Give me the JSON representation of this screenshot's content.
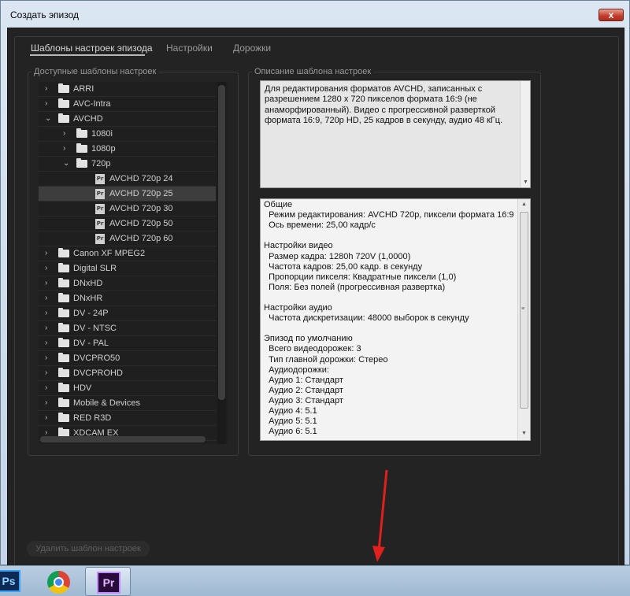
{
  "window": {
    "title": "Создать эпизод",
    "close_label": "x"
  },
  "tabs": [
    {
      "label": "Шаблоны настроек эпизода",
      "active": true
    },
    {
      "label": "Настройки",
      "active": false
    },
    {
      "label": "Дорожки",
      "active": false
    }
  ],
  "presets_panel": {
    "label": "Доступные шаблоны настроек",
    "tree": [
      {
        "label": "ARRI",
        "type": "folder",
        "level": 0,
        "expanded": false
      },
      {
        "label": "AVC-Intra",
        "type": "folder",
        "level": 0,
        "expanded": false
      },
      {
        "label": "AVCHD",
        "type": "folder",
        "level": 0,
        "expanded": true
      },
      {
        "label": "1080i",
        "type": "folder",
        "level": 1,
        "expanded": false
      },
      {
        "label": "1080p",
        "type": "folder",
        "level": 1,
        "expanded": false
      },
      {
        "label": "720p",
        "type": "folder",
        "level": 1,
        "expanded": true
      },
      {
        "label": "AVCHD 720p 24",
        "type": "preset",
        "level": 2
      },
      {
        "label": "AVCHD 720p 25",
        "type": "preset",
        "level": 2,
        "selected": true
      },
      {
        "label": "AVCHD 720p 30",
        "type": "preset",
        "level": 2
      },
      {
        "label": "AVCHD 720p 50",
        "type": "preset",
        "level": 2
      },
      {
        "label": "AVCHD 720p 60",
        "type": "preset",
        "level": 2
      },
      {
        "label": "Canon XF MPEG2",
        "type": "folder",
        "level": 0,
        "expanded": false
      },
      {
        "label": "Digital SLR",
        "type": "folder",
        "level": 0,
        "expanded": false
      },
      {
        "label": "DNxHD",
        "type": "folder",
        "level": 0,
        "expanded": false
      },
      {
        "label": "DNxHR",
        "type": "folder",
        "level": 0,
        "expanded": false
      },
      {
        "label": "DV - 24P",
        "type": "folder",
        "level": 0,
        "expanded": false
      },
      {
        "label": "DV - NTSC",
        "type": "folder",
        "level": 0,
        "expanded": false
      },
      {
        "label": "DV - PAL",
        "type": "folder",
        "level": 0,
        "expanded": false
      },
      {
        "label": "DVCPRO50",
        "type": "folder",
        "level": 0,
        "expanded": false
      },
      {
        "label": "DVCPROHD",
        "type": "folder",
        "level": 0,
        "expanded": false
      },
      {
        "label": "HDV",
        "type": "folder",
        "level": 0,
        "expanded": false
      },
      {
        "label": "Mobile & Devices",
        "type": "folder",
        "level": 0,
        "expanded": false
      },
      {
        "label": "RED R3D",
        "type": "folder",
        "level": 0,
        "expanded": false
      },
      {
        "label": "XDCAM EX",
        "type": "folder",
        "level": 0,
        "expanded": false
      }
    ],
    "preset_icon_text": "Pr"
  },
  "description_panel": {
    "label": "Описание шаблона настроек",
    "lines": [
      "Для редактирования форматов AVCHD, записанных с",
      "разрешением 1280 x 720 пикселов формата 16:9 (не",
      "анаморфированный). Видео с прогрессивной разверткой",
      "формата 16:9, 720p HD, 25 кадров в секунду, аудио 48 кГц."
    ]
  },
  "info": {
    "lines": [
      "Общие",
      " Режим редактирования: AVCHD 720p, пиксели формата 16:9",
      " Ось времени: 25,00 кадр/с",
      "",
      "Настройки видео",
      " Размер кадра: 1280h 720V (1,0000)",
      " Частота кадров: 25,00  кадр. в секунду",
      " Пропорции пикселя: Квадратные пиксели (1,0)",
      " Поля: Без полей (прогрессивная развертка)",
      "",
      "Настройки аудио",
      " Частота дискретизации: 48000 выборок в секунду",
      "",
      "Эпизод по умолчанию",
      " Всего видеодорожек: 3",
      " Тип главной дорожки: Стерео",
      " Аудиодорожки:",
      " Аудио 1: Стандарт",
      " Аудио 2: Стандарт",
      " Аудио 3: Стандарт",
      " Аудио 4: 5.1",
      " Аудио 5: 5.1",
      " Аудио 6: 5.1"
    ]
  },
  "delete_button": {
    "label": "Удалить шаблон настроек"
  },
  "taskbar": {
    "apps": [
      {
        "icon": "photoshop-icon",
        "text": "Ps"
      },
      {
        "icon": "chrome-icon",
        "text": ""
      },
      {
        "icon": "premiere-icon",
        "text": "Pr"
      }
    ]
  },
  "colors": {
    "annotation_arrow": "#e0201c",
    "dialog_background": "#232323"
  }
}
